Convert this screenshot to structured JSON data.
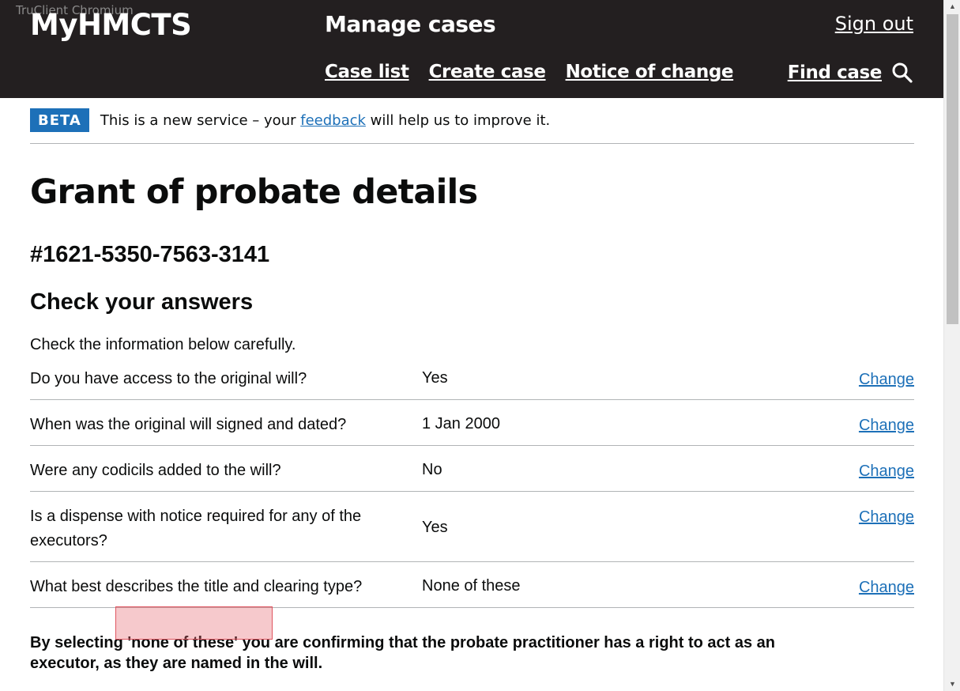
{
  "watermark": "TruClient Chromium",
  "header": {
    "logo": "MyHMCTS",
    "service_name": "Manage cases",
    "sign_out": "Sign out",
    "nav": [
      {
        "label": "Case list"
      },
      {
        "label": "Create case"
      },
      {
        "label": "Notice of change"
      }
    ],
    "find_case": "Find case",
    "search_icon": "magnifier-icon"
  },
  "beta": {
    "tag": "BETA",
    "text_before": "This is a new service – your ",
    "link": "feedback",
    "text_after": " will help us to improve it."
  },
  "page": {
    "title": "Grant of probate details",
    "case_reference": "#1621-5350-7563-3141",
    "section_title": "Check your answers",
    "intro": "Check the information below carefully."
  },
  "answers": [
    {
      "question": "Do you have access to the original will?",
      "answer": "Yes",
      "action": "Change"
    },
    {
      "question": "When was the original will signed and dated?",
      "answer": "1 Jan 2000",
      "action": "Change"
    },
    {
      "question": "Were any codicils added to the will?",
      "answer": "No",
      "action": "Change"
    },
    {
      "question": "Is a dispense with notice required for any of the executors?",
      "answer": "Yes",
      "action": "Change"
    },
    {
      "question": "What best describes the title and clearing type?",
      "answer": "None of these",
      "action": "Change"
    }
  ],
  "notice": "By selecting 'none of these' you are confirming that the probate practitioner has a right to act as an executor, as they are named in the will.",
  "colors": {
    "header_bg": "#231f20",
    "link": "#1d70b8",
    "beta_tag": "#1d70b8",
    "highlight": "#e05560"
  }
}
